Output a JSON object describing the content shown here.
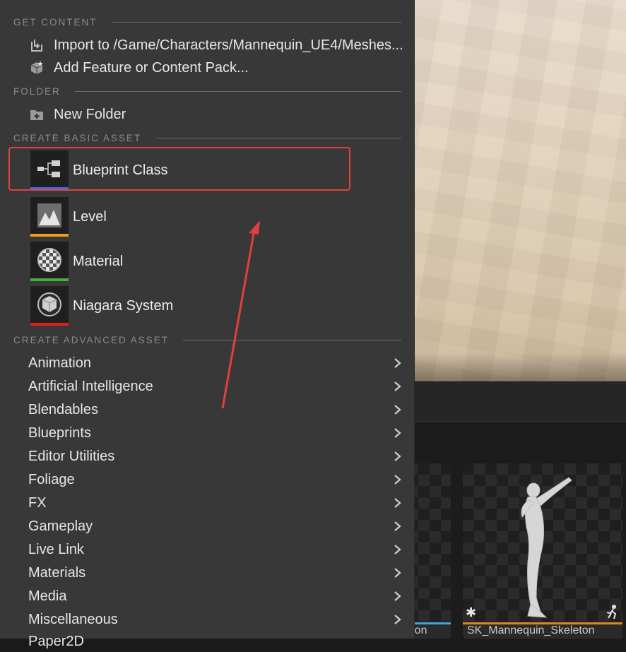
{
  "menu": {
    "sections": {
      "get_content": "GET CONTENT",
      "folder": "FOLDER",
      "basic": "CREATE BASIC ASSET",
      "advanced": "CREATE ADVANCED ASSET"
    },
    "get_content_items": [
      {
        "label": "Import to /Game/Characters/Mannequin_UE4/Meshes...",
        "icon": "import-icon"
      },
      {
        "label": "Add Feature or Content Pack...",
        "icon": "content-pack-icon"
      }
    ],
    "folder_items": [
      {
        "label": "New Folder",
        "icon": "new-folder-icon"
      }
    ],
    "basic_assets": [
      {
        "label": "Blueprint Class",
        "icon": "blueprint-icon",
        "color": "#3a6fe0"
      },
      {
        "label": "Level",
        "icon": "level-icon",
        "color": "#f39a1a"
      },
      {
        "label": "Material",
        "icon": "material-icon",
        "color": "#3fb23a"
      },
      {
        "label": "Niagara System",
        "icon": "niagara-icon",
        "color": "#e01f1f"
      }
    ],
    "advanced_assets": [
      "Animation",
      "Artificial Intelligence",
      "Blendables",
      "Blueprints",
      "Editor Utilities",
      "Foliage",
      "FX",
      "Gameplay",
      "Live Link",
      "Materials",
      "Media",
      "Miscellaneous",
      "Paper2D"
    ]
  },
  "content_browser": {
    "cards": [
      {
        "label": "...eton",
        "strip_color": "#3aa8d8"
      },
      {
        "label": "SK_Mannequin_Skeleton",
        "strip_color": "#d98a1e"
      }
    ]
  },
  "annotation": {
    "color": "#e0413b"
  }
}
